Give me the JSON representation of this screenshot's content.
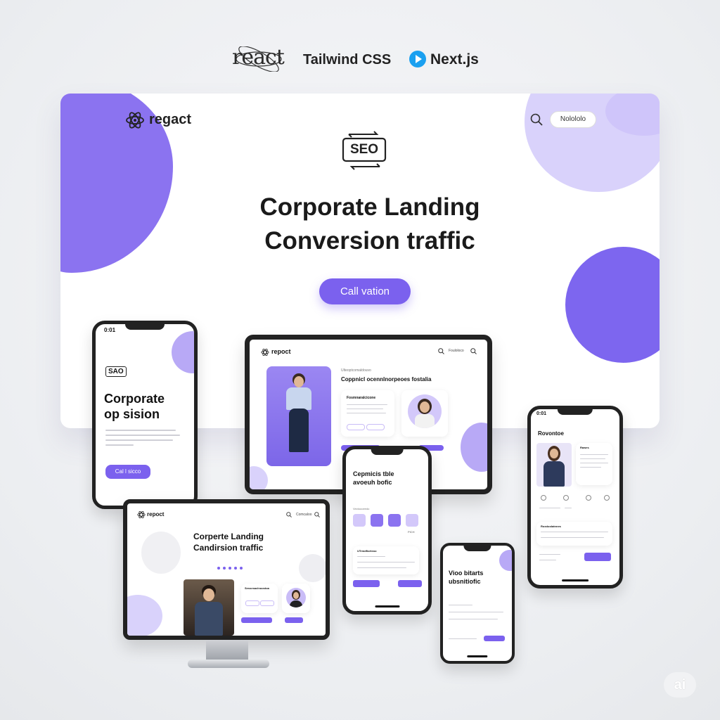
{
  "tech_strip": {
    "react": "react",
    "tailwind": "Tailwind CSS",
    "next": "Next.js"
  },
  "hero": {
    "logo": "regact",
    "nav_pill": "Nolololo",
    "seo_label": "SEO",
    "title_line1": "Corporate Landing",
    "title_line2": "Conversion traffic",
    "cta": "Call vation"
  },
  "phone_left": {
    "status_time": "0:01",
    "badge": "SAO",
    "title_line1": "Corporate",
    "title_line2": "op sision",
    "cta": "Cal l sicco"
  },
  "tablet_center": {
    "logo": "repoct",
    "nav_text": "Fouloloco",
    "eyebrow": "Ulteoptcomaldouvo",
    "heading": "Coppnicl ocennlnorpeoes fostalia",
    "card_title": "Fosmnaralcicone"
  },
  "monitor": {
    "logo": "repoct",
    "nav_text": "Comcaloo",
    "title_line1": "Corperte Landing",
    "title_line2": "Candirsion traffic",
    "card_title": "Sessesaclnoostoa"
  },
  "phone_mid": {
    "title_line1": "Cepmicis tble",
    "title_line2": "avoeuh bofic",
    "eyebrow": "Vectoooeedo",
    "sub_tag": "PICH",
    "list_title": "UTrmdfiorteoo"
  },
  "phone_small": {
    "title_line1": "Vioo bitarts",
    "title_line2": "ubsnitiofic"
  },
  "phone_right": {
    "status_time": "0:01",
    "title": "Rovontoe",
    "card_tag": "Rawes",
    "list_title": "Roxdoolatnnes"
  },
  "badge_ai": "ai",
  "colors": {
    "accent": "#7b61ee",
    "accent_light": "#d9d2fb",
    "blob": "#8b73f0",
    "dark": "#1a1a1a"
  }
}
